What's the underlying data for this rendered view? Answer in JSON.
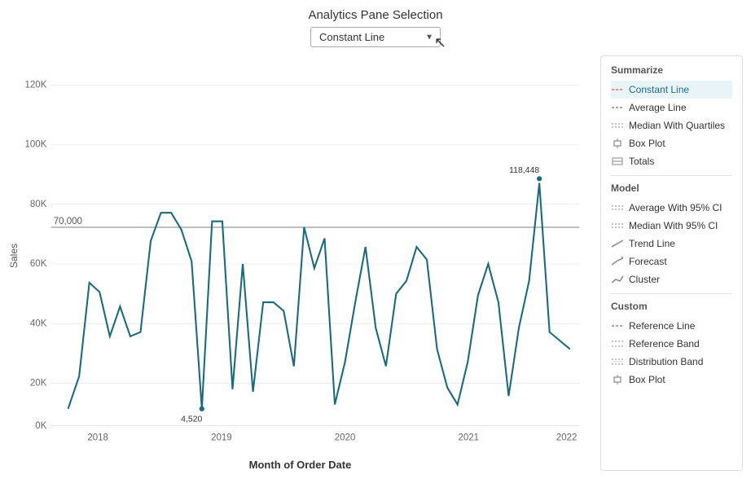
{
  "header": {
    "title": "Analytics Pane Selection",
    "dropdown_value": "Constant Line",
    "dropdown_placeholder": "Constant Line"
  },
  "chart": {
    "y_axis_label": "Sales",
    "x_axis_label": "Month of Order Date",
    "y_ticks": [
      "120K",
      "100K",
      "80K",
      "60K",
      "40K",
      "20K",
      "0K"
    ],
    "x_ticks": [
      "2018",
      "2019",
      "2020",
      "2021",
      "2022"
    ],
    "reference_line_value": "70,000",
    "min_label": "4,520",
    "max_label": "118,448",
    "accent_color": "#1a6b7c",
    "line_color": "#888"
  },
  "analytics_panel": {
    "sections": [
      {
        "title": "Summarize",
        "items": [
          {
            "label": "Constant Line",
            "icon": "dashed-line",
            "selected": true
          },
          {
            "label": "Average Line",
            "icon": "dashed-line",
            "selected": false
          },
          {
            "label": "Median With Quartiles",
            "icon": "dashed-line",
            "selected": false
          },
          {
            "label": "Box Plot",
            "icon": "box-plot",
            "selected": false
          },
          {
            "label": "Totals",
            "icon": "totals",
            "selected": false
          }
        ]
      },
      {
        "title": "Model",
        "items": [
          {
            "label": "Average With 95% CI",
            "icon": "dashed-line",
            "selected": false
          },
          {
            "label": "Median With 95% CI",
            "icon": "dashed-line",
            "selected": false
          },
          {
            "label": "Trend Line",
            "icon": "trend-line",
            "selected": false
          },
          {
            "label": "Forecast",
            "icon": "forecast",
            "selected": false
          },
          {
            "label": "Cluster",
            "icon": "cluster",
            "selected": false
          }
        ]
      },
      {
        "title": "Custom",
        "items": [
          {
            "label": "Reference Line",
            "icon": "dashed-line",
            "selected": false
          },
          {
            "label": "Reference Band",
            "icon": "dashed-line",
            "selected": false
          },
          {
            "label": "Distribution Band",
            "icon": "dashed-line",
            "selected": false
          },
          {
            "label": "Box Plot",
            "icon": "box-plot2",
            "selected": false
          }
        ]
      }
    ]
  }
}
